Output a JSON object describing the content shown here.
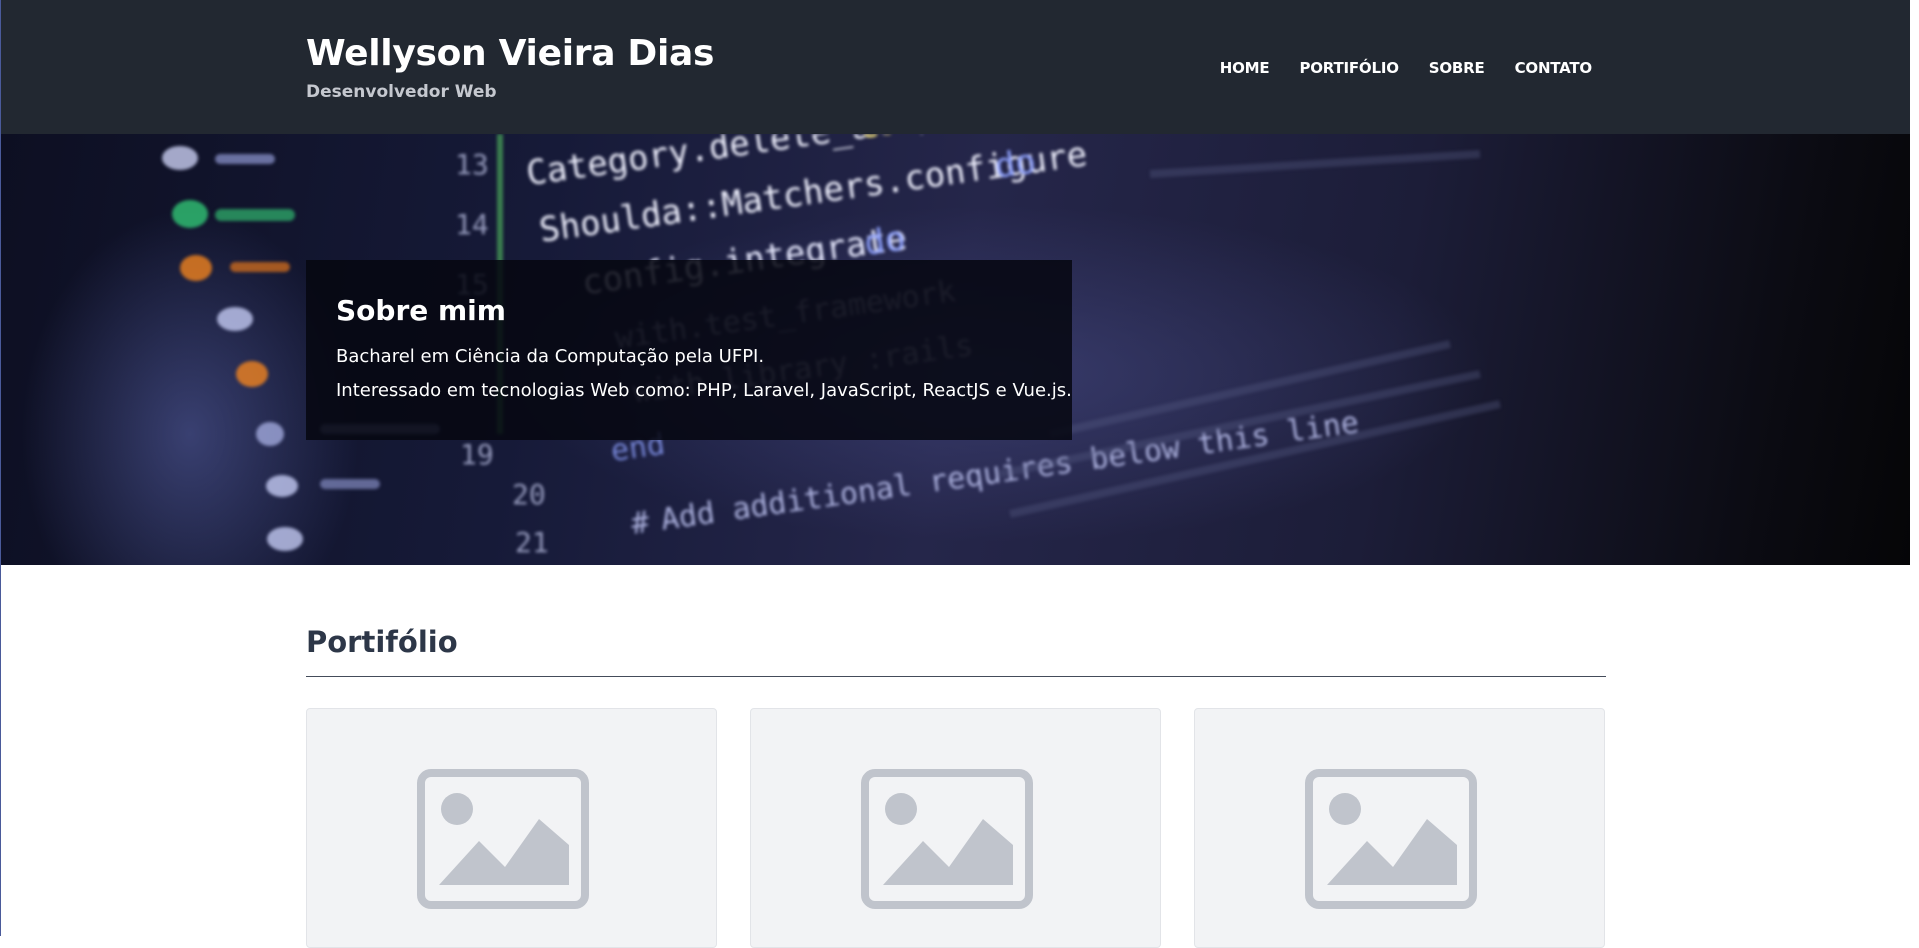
{
  "header": {
    "title": "Wellyson Vieira Dias",
    "subtitle": "Desenvolvedor Web",
    "nav": [
      {
        "label": "HOME"
      },
      {
        "label": "PORTIFÓLIO"
      },
      {
        "label": "SOBRE"
      },
      {
        "label": "CONTATO"
      }
    ]
  },
  "hero": {
    "background": "blurred-code-editor-photo",
    "about": {
      "title": "Sobre mim",
      "line1": "Bacharel em Ciência da Computação pela UFPI.",
      "line2": "Interessado em tecnologias Web como: PHP, Laravel, JavaScript, ReactJS e Vue.js."
    }
  },
  "portfolio": {
    "title": "Portifólio",
    "cards": [
      {
        "icon": "image-placeholder-icon"
      },
      {
        "icon": "image-placeholder-icon"
      },
      {
        "icon": "image-placeholder-icon"
      }
    ]
  },
  "colors": {
    "header_bg": "#222831",
    "heading": "#2d3748",
    "card_bg": "#f2f3f5",
    "placeholder_icon": "#c0c4cc"
  }
}
